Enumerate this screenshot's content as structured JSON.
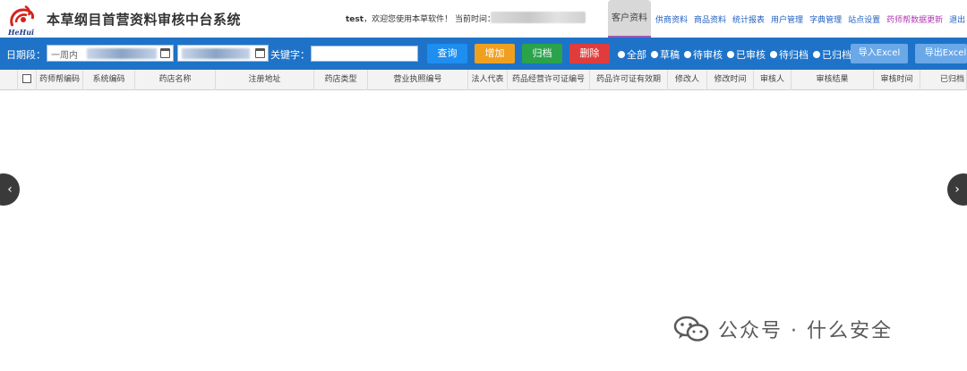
{
  "header": {
    "logo_text": "HeHui",
    "app_title": "本草纲目首营资料审核中台系统",
    "user": "test",
    "welcome": "，欢迎您使用本草软件！ 当前时间：",
    "nav": [
      {
        "label": "客户资料",
        "active": true
      },
      {
        "label": "供商资料"
      },
      {
        "label": "商品资料"
      },
      {
        "label": "统计报表"
      },
      {
        "label": "用户管理"
      },
      {
        "label": "字典管理"
      },
      {
        "label": "站点设置"
      },
      {
        "label": "药师帮数据更新",
        "highlight": true
      },
      {
        "label": "退出"
      }
    ]
  },
  "toolbar": {
    "date_label": "日期段：",
    "date_start": "一周内",
    "keyword_label": "关键字：",
    "keyword_value": "",
    "buttons": {
      "query": "查询",
      "add": "增加",
      "archive": "归档",
      "delete": "删除"
    },
    "button_colors": {
      "query": "#1e8ef0",
      "add": "#f0a020",
      "archive": "#2aa34a",
      "delete": "#e03c3c"
    },
    "filters": [
      "全部",
      "草稿",
      "待审核",
      "已审核",
      "待归档",
      "已归档"
    ],
    "import_excel": "导入Excel",
    "export_excel": "导出Excel"
  },
  "table": {
    "columns": [
      "药师帮编码",
      "系统编码",
      "药店名称",
      "注册地址",
      "药店类型",
      "营业执照编号",
      "法人代表",
      "药品经营许可证编号",
      "药品许可证有效期",
      "修改人",
      "修改时间",
      "审核人",
      "审核结果",
      "审核时间",
      "已归档"
    ],
    "rows": []
  },
  "watermark": {
    "text": "公众号 · 什么安全"
  },
  "colors": {
    "toolbar_bg": "#1e73c8",
    "nav_link": "#1f5fbf"
  }
}
